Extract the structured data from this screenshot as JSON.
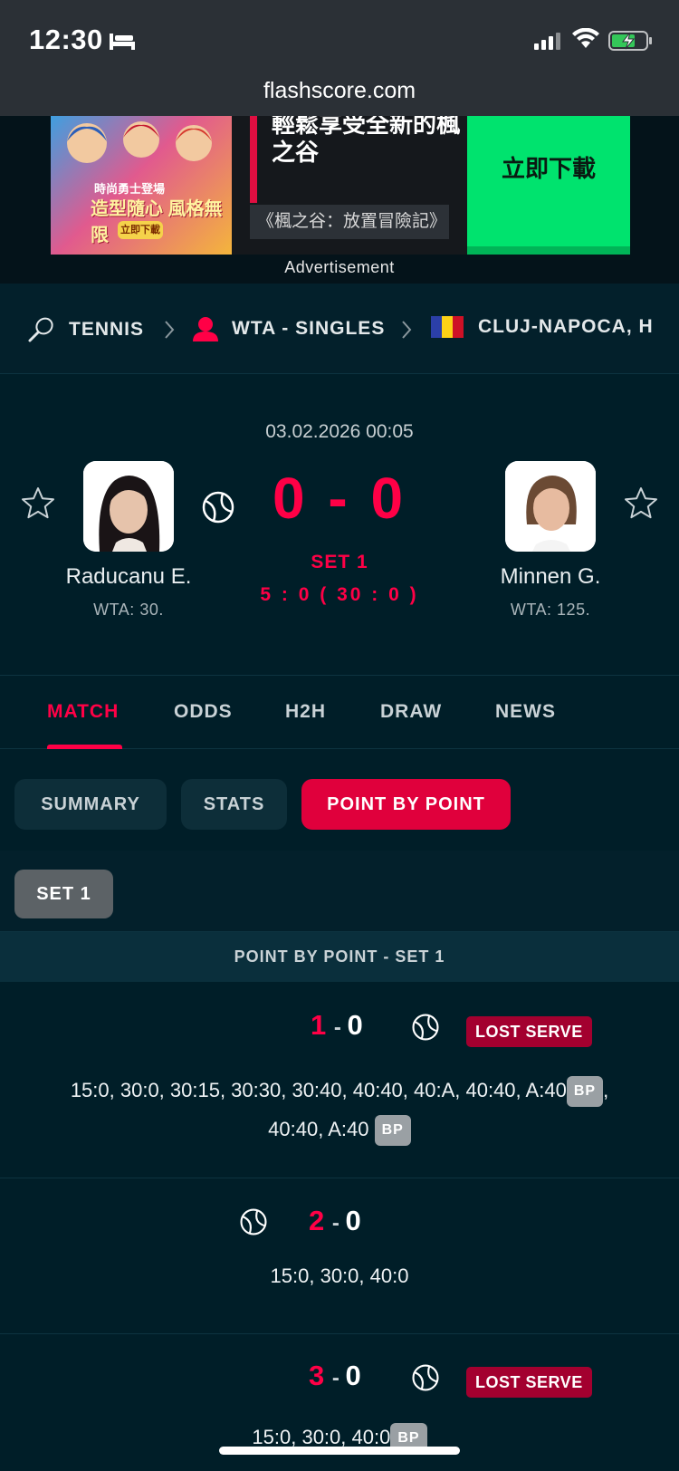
{
  "status_bar": {
    "time": "12:30"
  },
  "browser": {
    "url": "flashscore.com"
  },
  "ad": {
    "art_line1": "時尚勇士登場",
    "art_line2": "造型隨心 風格無限",
    "art_button": "立即下載",
    "headline": "輕鬆享受全新的楓之谷",
    "subtitle": "《楓之谷：放置冒險記》",
    "cta": "立即下載",
    "label": "Advertisement"
  },
  "breadcrumb": {
    "sport": "TENNIS",
    "category": "WTA - SINGLES",
    "tournament": "CLUJ-NAPOCA, H"
  },
  "match": {
    "datetime": "03.02.2026 00:05",
    "score": "0 - 0",
    "status": "SET 1",
    "game_score": "5 : 0 ( 30 : 0 )",
    "home": {
      "name": "Raducanu E.",
      "rank": "WTA: 30."
    },
    "away": {
      "name": "Minnen G.",
      "rank": "WTA: 125."
    }
  },
  "tabs": {
    "match": "MATCH",
    "odds": "ODDS",
    "h2h": "H2H",
    "draw": "DRAW",
    "news": "NEWS"
  },
  "subtabs": {
    "summary": "SUMMARY",
    "stats": "STATS",
    "pbp": "POINT BY POINT"
  },
  "set_filter": "SET 1",
  "pbp_title": "POINT BY POINT - SET 1",
  "games": [
    {
      "home": "1",
      "away": "0",
      "tag": "LOST SERVE",
      "line1": "15:0, 30:0, 30:15, 30:30, 30:40, 40:40, 40:A, 40:40, A:40",
      "bp1": "BP",
      "line2": "40:40, A:40",
      "bp2": "BP"
    },
    {
      "home": "2",
      "away": "0",
      "line1": "15:0, 30:0, 40:0"
    },
    {
      "home": "3",
      "away": "0",
      "tag": "LOST SERVE",
      "line1": "15:0, 30:0, 40:0",
      "bp1": "BP"
    }
  ],
  "colors": {
    "accent": "#ff0046",
    "background": "#001e28",
    "active_pill": "#e0003c",
    "lost_serve": "#a3002f"
  }
}
